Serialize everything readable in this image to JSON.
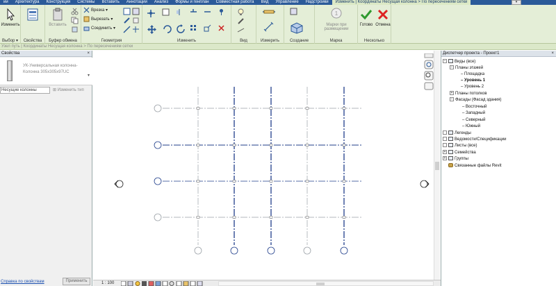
{
  "tabs": [
    {
      "label": "ий"
    },
    {
      "label": "Архитектура"
    },
    {
      "label": "Конструкция"
    },
    {
      "label": "Системы"
    },
    {
      "label": "Вставить"
    },
    {
      "label": "Аннотации"
    },
    {
      "label": "Анализ"
    },
    {
      "label": "Формы и генплан"
    },
    {
      "label": "Совместная работа"
    },
    {
      "label": "Вид"
    },
    {
      "label": "Управление"
    },
    {
      "label": "Надстройки"
    },
    {
      "label": "Изменить | Координаты Несущая колонна > По пересечениям сетки"
    }
  ],
  "ribbon": {
    "select": {
      "modify_label": "Изменить",
      "group_label": "Выбор ▾"
    },
    "properties": {
      "group_label": "Свойства"
    },
    "clipboard": {
      "paste_label": "Вставить",
      "group_label": "Буфер обмена"
    },
    "geometry": {
      "cut_label": "Врезка",
      "cutout_label": "Вырезать",
      "join_label": "Соединить",
      "group_label": "Геометрия"
    },
    "modify": {
      "group_label": "Изменить"
    },
    "view": {
      "group_label": "Вид"
    },
    "measure": {
      "group_label": "Измерить"
    },
    "create": {
      "group_label": "Создание"
    },
    "tags": {
      "tag_label": "Марки при размещении",
      "group_label": "Марка"
    },
    "multiple": {
      "finish_label": "Готово",
      "cancel_label": "Отмена",
      "group_label": "Несколько"
    }
  },
  "context_bar": {
    "text": "Узел путь | Координаты Несущая колонна > По пересечениям сетки"
  },
  "properties": {
    "title": "Свойства",
    "type_name": "УК-Универсальная колонна-Колонна 305x305x97UC",
    "selector": "Несущие колонны",
    "edit_type": "Изменить тип",
    "link": "Справка по свойствам",
    "apply": "Применить"
  },
  "view_bar": {
    "scale": "1 : 100"
  },
  "browser": {
    "title": "Диспетчер проекта - Проект1",
    "nodes": [
      {
        "label": "Виды (все)"
      },
      {
        "label": "Планы этажей"
      },
      {
        "label": "Площадка"
      },
      {
        "label": "Уровень 1"
      },
      {
        "label": "Уровень 2"
      },
      {
        "label": "Планы потолков"
      },
      {
        "label": "Фасады (Фасад здания)"
      },
      {
        "label": "Восточный"
      },
      {
        "label": "Западный"
      },
      {
        "label": "Северный"
      },
      {
        "label": "Южный"
      },
      {
        "label": "Легенды"
      },
      {
        "label": "Ведомости/Спецификации"
      },
      {
        "label": "Листы (все)"
      },
      {
        "label": "Семейства"
      },
      {
        "label": "Группы"
      },
      {
        "label": "Связанные файлы Revit"
      }
    ]
  },
  "colors": {
    "accent": "#2b5a99",
    "ribbon_bg": "#e4eed7",
    "grid_selected": "#1f3d8a",
    "grid_dim": "#9aa0a6"
  }
}
